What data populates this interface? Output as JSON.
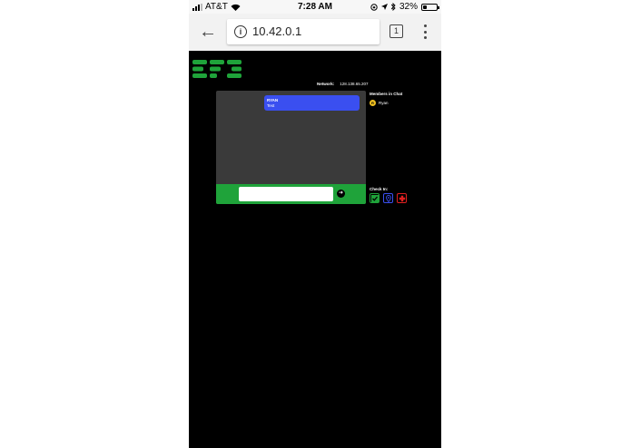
{
  "status_bar": {
    "carrier": "AT&T",
    "time": "7:28 AM",
    "battery": "32%",
    "battery_level": 0.32
  },
  "browser": {
    "url": "10.42.0.1",
    "tab_count": "1"
  },
  "page": {
    "network_label": "Network:",
    "network_value": "128.138.65.207",
    "chat": {
      "messages": [
        {
          "sender": "RYAN",
          "text": "Test"
        }
      ],
      "input_placeholder": ""
    },
    "members_title": "Members in Chat",
    "members": [
      {
        "initial": "R",
        "name": "Ryan"
      }
    ],
    "checkin_title": "Check In:",
    "checkin_buttons": [
      {
        "icon": "checkmark-icon",
        "color": "#1fa33a"
      },
      {
        "icon": "location-pin-icon",
        "color": "#3a4ff0"
      },
      {
        "icon": "medical-cross-icon",
        "color": "#e02020"
      }
    ],
    "colors": {
      "brand_green": "#1fa33a",
      "bubble_blue": "#3a4ff0",
      "alert_red": "#e02020",
      "avatar_yellow": "#f0c020"
    }
  }
}
